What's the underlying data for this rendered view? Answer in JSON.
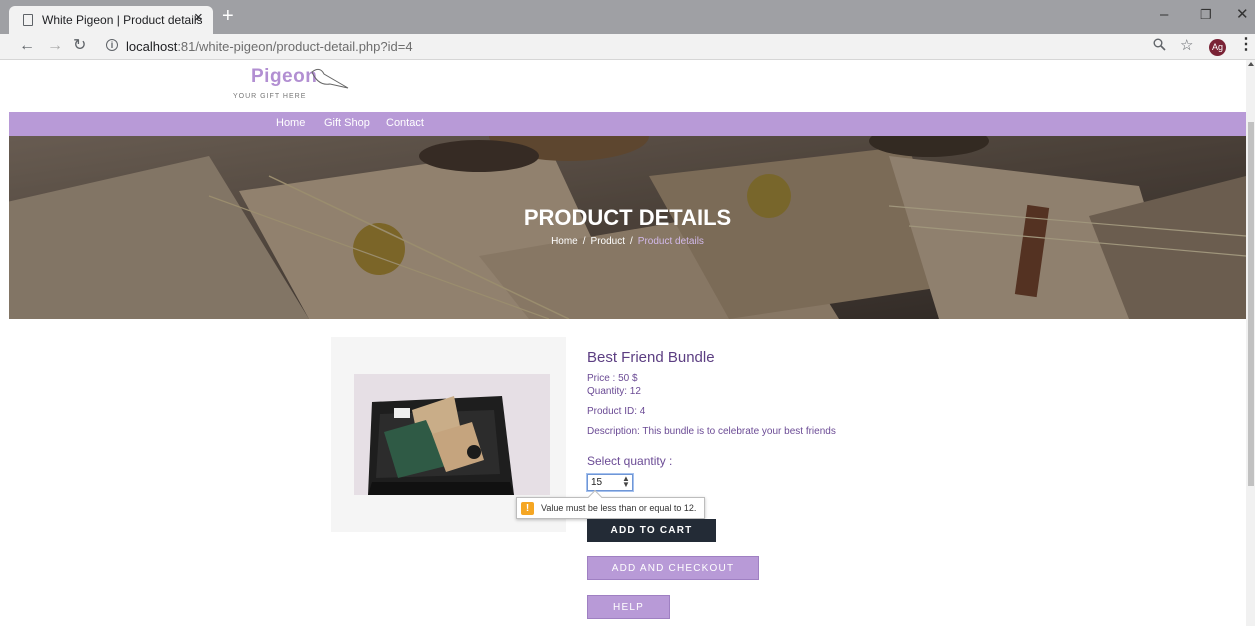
{
  "browser": {
    "tab_title": "White Pigeon | Product details",
    "tab_close": "×",
    "new_tab": "+",
    "url_host": "localhost",
    "url_rest": ":81/white-pigeon/product-detail.php?id=4",
    "profile_initials": "Ag",
    "minimize": "–",
    "restore": "❐",
    "close": "✕"
  },
  "site": {
    "logo_text": "Pigeon",
    "logo_tagline": "YOUR GIFT HERE",
    "brand_color": "#b89ad7"
  },
  "nav": {
    "items": [
      "Home",
      "Gift Shop",
      "Contact"
    ]
  },
  "hero": {
    "title": "PRODUCT DETAILS",
    "breadcrumb": [
      "Home",
      "Product",
      "Product details"
    ],
    "separator": "/"
  },
  "product": {
    "name": "Best Friend Bundle",
    "price": "Price : 50 $",
    "quantity": "Quantity: 12",
    "product_id": "Product ID: 4",
    "description": "Description: This bundle is to celebrate your best friends",
    "select_quantity_label": "Select quantity :",
    "quantity_value": "15"
  },
  "validation": {
    "message": "Value must be less than or equal to 12.",
    "icon": "!"
  },
  "buttons": {
    "add_to_cart": "ADD TO CART",
    "add_and_checkout": "ADD AND CHECKOUT",
    "help": "HELP"
  }
}
